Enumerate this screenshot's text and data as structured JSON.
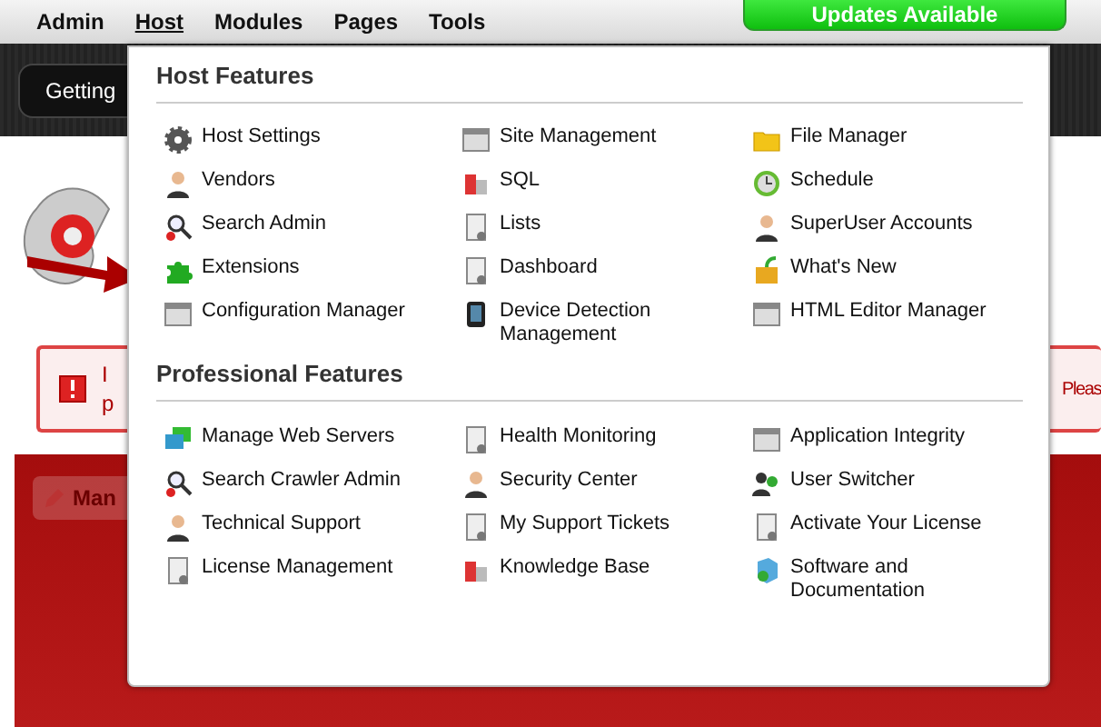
{
  "nav": {
    "items": [
      {
        "label": "Admin",
        "selected": false
      },
      {
        "label": "Host",
        "selected": true
      },
      {
        "label": "Modules",
        "selected": false
      },
      {
        "label": "Pages",
        "selected": false
      },
      {
        "label": "Tools",
        "selected": false
      }
    ],
    "updates_button": "Updates Available"
  },
  "page": {
    "getting_started_button": "Getting",
    "alert": {
      "lines": [
        "I",
        "p"
      ],
      "right_text": "Pleas"
    },
    "manage_button": "Man"
  },
  "menu": {
    "sections": [
      {
        "title": "Host Features",
        "items": [
          "Host Settings",
          "Site Management",
          "File Manager",
          "Vendors",
          "SQL",
          "Schedule",
          "Search Admin",
          "Lists",
          "SuperUser Accounts",
          "Extensions",
          "Dashboard",
          "What's New",
          "Configuration Manager",
          "Device Detection Management",
          "HTML Editor Manager"
        ]
      },
      {
        "title": "Professional Features",
        "items": [
          "Manage Web Servers",
          "Health Monitoring",
          "Application Integrity",
          "Search Crawler Admin",
          "Security Center",
          "User Switcher",
          "Technical Support",
          "My Support Tickets",
          "Activate Your License",
          "License Management",
          "Knowledge Base",
          "Software and Documentation"
        ]
      }
    ]
  }
}
